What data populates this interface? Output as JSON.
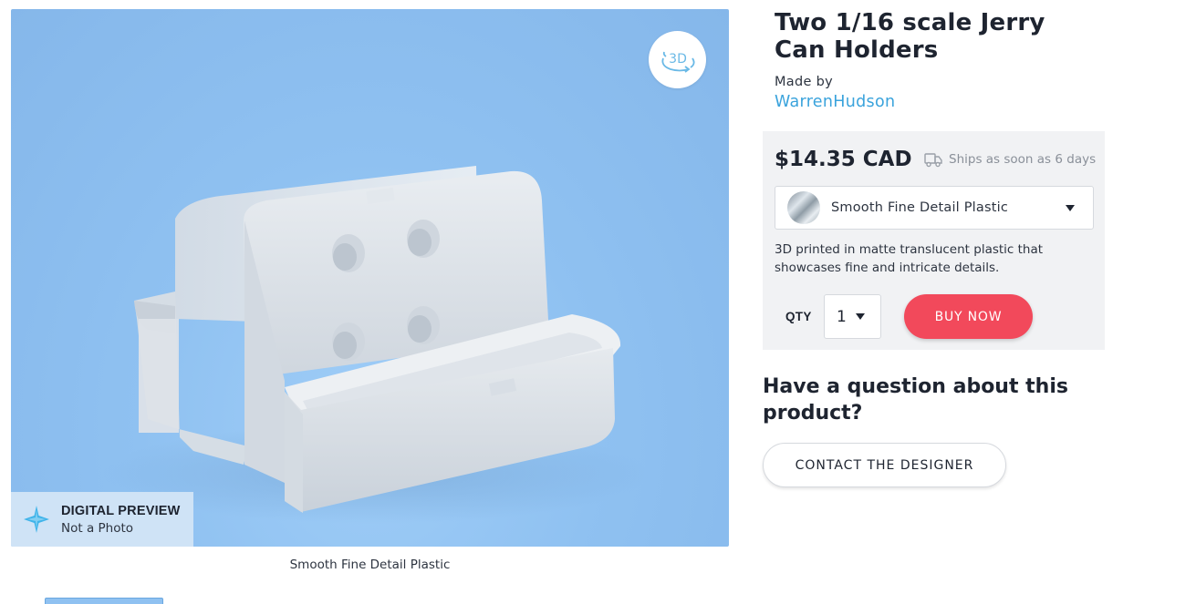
{
  "product": {
    "title": "Two 1/16 scale Jerry Can Holders",
    "made_by_label": "Made by",
    "designer": "WarrenHudson"
  },
  "preview": {
    "toggle_3d_label": "3D",
    "badge_title": "DIGITAL PREVIEW",
    "badge_subtitle": "Not a Photo",
    "caption": "Smooth Fine Detail Plastic"
  },
  "purchase": {
    "price": "$14.35 CAD",
    "ships_text": "Ships as soon as 6 days",
    "material_selected": "Smooth Fine Detail Plastic",
    "material_description": "3D printed in matte translucent plastic that showcases fine and intricate details.",
    "qty_label": "QTY",
    "qty_value": "1",
    "buy_label": "BUY NOW"
  },
  "contact": {
    "question": "Have a question about this product?",
    "button_label": "CONTACT THE DESIGNER"
  },
  "colors": {
    "preview_bg": "#8fc1f1",
    "buy_button": "#f2495b",
    "designer_link": "#3aa3dc",
    "panel_bg": "#f1f2f4"
  },
  "icons": [
    "rotate-3d-icon",
    "sparkle-icon",
    "truck-icon",
    "chevron-down-icon",
    "material-swatch"
  ]
}
